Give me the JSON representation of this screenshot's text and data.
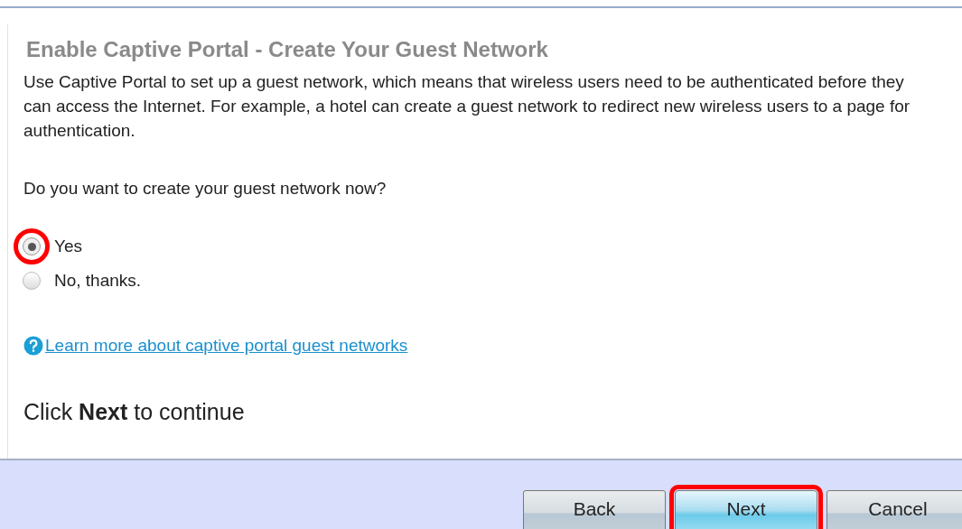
{
  "title": "Enable Captive Portal - Create Your Guest Network",
  "description": "Use Captive Portal to set up a guest network, which means that wireless users need to be authenticated before they can access the Internet. For example, a hotel can create a guest network to redirect new wireless users to a page for authentication.",
  "question": "Do you want to create your guest network now?",
  "options": [
    {
      "label": "Yes",
      "selected": true,
      "highlighted": true
    },
    {
      "label": "No, thanks.",
      "selected": false,
      "highlighted": false
    }
  ],
  "help_link": "Learn more about captive portal guest networks",
  "instruction": "Click **Next** to continue",
  "buttons": [
    {
      "label": "Back",
      "primary": false,
      "highlighted": false
    },
    {
      "label": "Next",
      "primary": true,
      "highlighted": true
    },
    {
      "label": "Cancel",
      "primary": false,
      "highlighted": false
    }
  ]
}
